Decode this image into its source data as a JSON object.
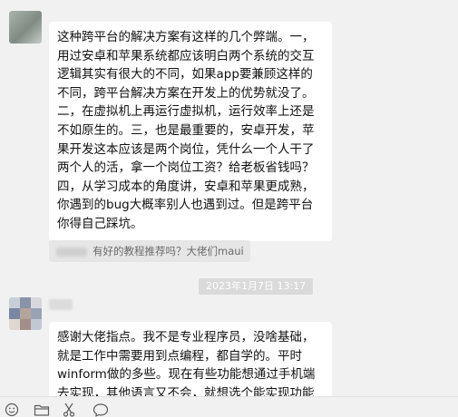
{
  "messages": [
    {
      "sender": "other",
      "text": "这种跨平台的解决方案有这样的几个弊端。一，\n用过安卓和苹果系统都应该明白两个系统的交互\n逻辑其实有很大的不同，如果app要兼顾这样的\n不同，跨平台解决方案在开发上的优势就没了。\n二，在虚拟机上再运行虚拟机，运行效率上还是\n不如原生的。三，也是最重要的，安卓开发，苹\n果开发这本应该是两个岗位，凭什么一个人干了\n两个人的活，拿一个岗位工资？给老板省钱吗？\n四，从学习成本的角度讲，安卓和苹果更成熟，\n你遇到的bug大概率别人也遇到过。但是跨平台\n你得自己踩坑。"
    }
  ],
  "quote": {
    "text": "有好的教程推荐吗？大佬们maui"
  },
  "timestamp": "2023年1月7日 13:17",
  "messages_2": [
    {
      "sender": "other",
      "text": "感谢大佬指点。我不是专业程序员，没啥基础，\n就是工作中需要用到点编程，都自学的。平时\nwinform做的多些。现在有些功能想通过手机端\n去实现，其他语言又不会，就想选个能实现功能"
    }
  ],
  "toolbar": {
    "icons": [
      "emoji-icon",
      "folder-icon",
      "scissors-icon",
      "chat-bubble-icon"
    ]
  },
  "colors": {
    "background": "#f1f1f1",
    "bubble": "#ffffff",
    "timestamp_bg": "#dadada"
  }
}
